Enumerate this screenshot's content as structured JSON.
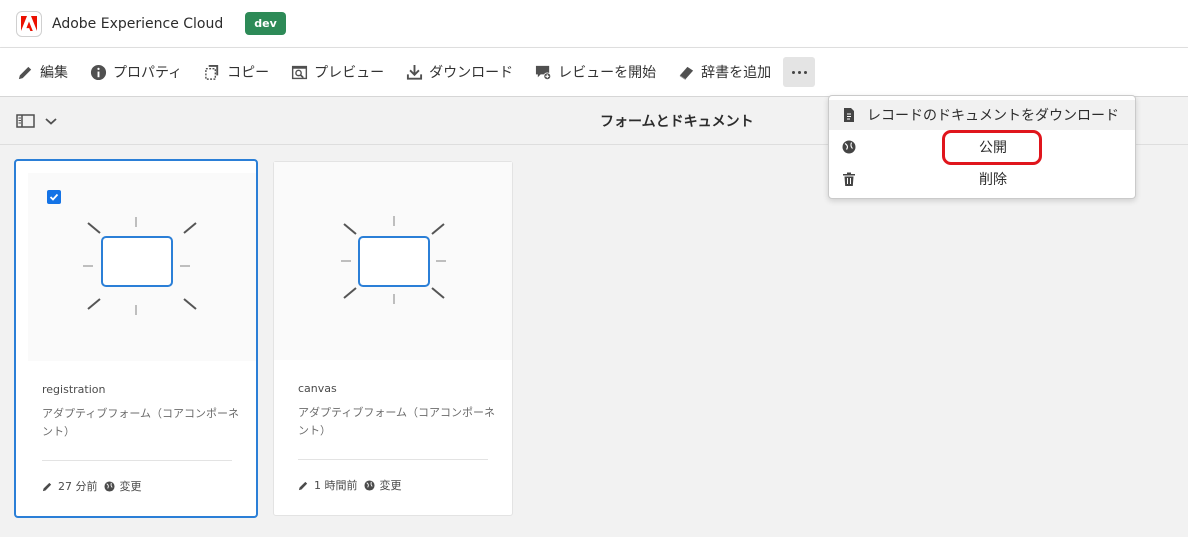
{
  "header": {
    "app_title": "Adobe Experience Cloud",
    "env_badge": "dev",
    "brand_color": "#eb1000",
    "badge_color": "#2d8a57"
  },
  "toolbar": {
    "items": [
      {
        "label": "編集",
        "icon": "pencil-icon"
      },
      {
        "label": "プロパティ",
        "icon": "info-icon"
      },
      {
        "label": "コピー",
        "icon": "copy-icon"
      },
      {
        "label": "プレビュー",
        "icon": "preview-icon"
      },
      {
        "label": "ダウンロード",
        "icon": "download-icon"
      },
      {
        "label": "レビューを開始",
        "icon": "review-icon"
      },
      {
        "label": "辞書を追加",
        "icon": "dictionary-icon"
      }
    ],
    "more_icon": "more-icon"
  },
  "subheader": {
    "page_title": "フォームとドキュメント"
  },
  "cards": [
    {
      "title": "registration",
      "description": "アダプティブフォーム（コアコンポーネント）",
      "modified": "27 分前",
      "status": "変更",
      "selected": true
    },
    {
      "title": "canvas",
      "description": "アダプティブフォーム（コアコンポーネント）",
      "modified": "1 時間前",
      "status": "変更",
      "selected": false
    }
  ],
  "more_menu": {
    "items": [
      {
        "label": "レコードのドキュメントをダウンロード",
        "icon": "pdf-document-icon"
      },
      {
        "label": "公開",
        "icon": "globe-icon"
      },
      {
        "label": "削除",
        "icon": "trash-icon"
      }
    ]
  },
  "accent_color": "#1473e6",
  "annotation_color": "#e0151c"
}
